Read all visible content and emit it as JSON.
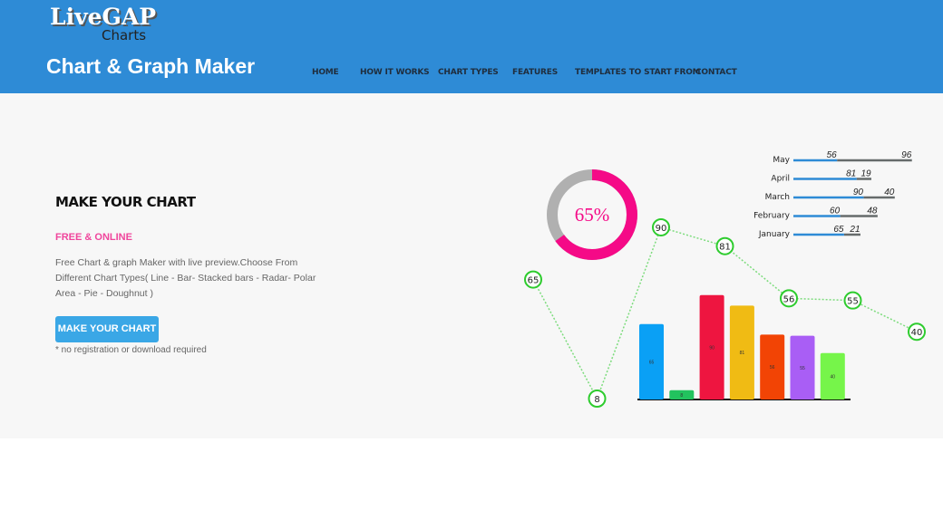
{
  "header": {
    "logo": {
      "main": "LiveGAP",
      "sub": "Charts"
    },
    "title": "Chart & Graph Maker",
    "nav": [
      {
        "label": "HOME"
      },
      {
        "label": "HOW IT WORKS"
      },
      {
        "label": "CHART TYPES"
      },
      {
        "label": "FEATURES"
      },
      {
        "label": "TEMPLATES TO START FROM"
      },
      {
        "label": "CONTACT"
      }
    ],
    "color": "#2e8bd6"
  },
  "hero": {
    "title": "MAKE YOUR CHART",
    "subtitle": "FREE & ONLINE",
    "description": "Free Chart & graph Maker with live preview.Choose From Different Chart Types( Line - Bar- Stacked bars - Radar- Polar Area - Pie - Doughnut )",
    "button_label": "MAKE YOUR CHART",
    "note": "* no registration or download required"
  },
  "illustration": {
    "doughnut": {
      "value": 65,
      "label": "65%",
      "colors": [
        "#f50a87",
        "#b0b0b0"
      ]
    },
    "line": {
      "values": [
        65,
        8,
        90,
        81,
        56,
        55,
        40
      ],
      "labels": [
        "65",
        "8",
        "90",
        "81",
        "56",
        "55",
        "40"
      ],
      "color": "#2ecc2e"
    },
    "bars": {
      "values": [
        65,
        8,
        90,
        81,
        56,
        55,
        40
      ],
      "labels": [
        "65",
        "8",
        "90",
        "81",
        "56",
        "55",
        "40"
      ],
      "colors": [
        "#0aa0f5",
        "#22c35e",
        "#ee1540",
        "#f0bb14",
        "#f24405",
        "#a95ef5",
        "#76f54a"
      ]
    },
    "stacked": {
      "rows": [
        {
          "label": "May",
          "a": 56,
          "b": 96,
          "a_label": "56",
          "b_label": "96"
        },
        {
          "label": "April",
          "a": 81,
          "b": 19,
          "a_label": "81",
          "b_label": "19"
        },
        {
          "label": "March",
          "a": 90,
          "b": 40,
          "a_label": "90",
          "b_label": "40"
        },
        {
          "label": "February",
          "a": 60,
          "b": 48,
          "a_label": "60",
          "b_label": "48"
        },
        {
          "label": "January",
          "a": 65,
          "b": 21,
          "a_label": "65",
          "b_label": "21"
        }
      ],
      "colors": [
        "#2e8bd6",
        "#666b6b"
      ]
    }
  }
}
